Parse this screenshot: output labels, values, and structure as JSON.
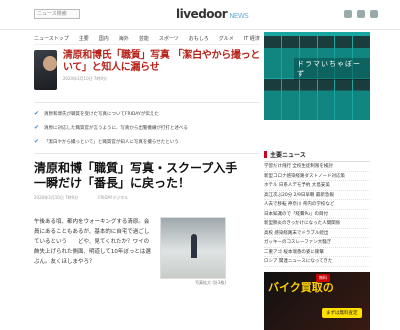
{
  "header": {
    "search_placeholder": "ニュース検索",
    "logo": "livedoor",
    "logo_sub": "NEWS"
  },
  "nav": [
    "ニューストップ",
    "主要",
    "国内",
    "海外",
    "芸能",
    "スポーツ",
    "おもしろ",
    "グルメ",
    "IT 経済"
  ],
  "hero": {
    "title": "清原和博氏「職質」写真 「潔白やから撮っといて」と知人に漏らせ",
    "date": "2020年3月10日 7時0分"
  },
  "bullets": [
    "清原和博氏が職質を受けた写真についてFRIDAYが伝えた",
    "清原に対応した職質官が言うように、写真から出警機嫌が打打と述べる",
    "「潔白やから撮っといて」と職質官が知人に写真を撮らせたという"
  ],
  "article": {
    "headline": "清原和博「職質」写真・スクープ入手　一瞬だけ「番長」に戻った！",
    "byline_1": "2020年3月10日 7時0分",
    "byline_2": "FRIDAYデジタル",
    "body": "午後ある頃、都内をウォーキングする清原。会員にあることもあるが、基本的に自宅で過ごしているという　　どや、見てくれたか？ワイの飾失上げられた側面、明道して10年ぼっとは選ぶん。友くほしまやろ？",
    "photo_caption": "写真拡大 (計3枚)"
  },
  "sidebar": {
    "ad1_text": "ドラマいちゃぼーず",
    "news_heading": "主要ニュース",
    "news_items": [
      "学習だけ飛行 全校生徒制限を検討",
      "新型コロナ感染経路ダストノード対応策",
      "ホテル 日系人デモ予約 大島安美",
      "高江次ぶ20分 2/9日早朝 最新急報",
      "人去で移転 神奈川 県内の学校など",
      "日本知識ので「経費Pu」の目付",
      "新型肺炎のきっかけになった人間関係",
      "高校 感染経路末でドラブル続出",
      "ガッキーのコスレーファン大騒ぎ",
      "二重アゴ 桜本瑞香の姿に衝撃",
      "ロシア 関連ニュースになってきた"
    ],
    "ad2_text": "バイク買取の",
    "ad2_badge": "無料",
    "ad2_cta": "まずは無料査定"
  }
}
